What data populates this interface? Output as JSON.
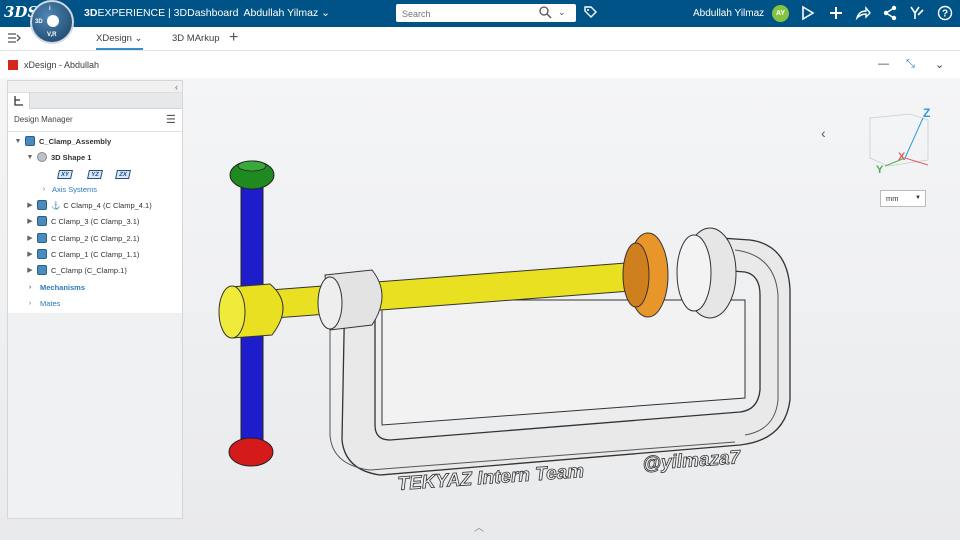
{
  "topbar": {
    "logo": "3DS",
    "compass": {
      "q1": "3D",
      "q2": "V,R",
      "q3": "i"
    },
    "brand_prefix": "3D",
    "brand_main": "EXPERIENCE | 3DDashboard",
    "brand_user": "Abdullah Yilmaz ⌄",
    "search_placeholder": "Search",
    "user_name": "Abdullah Yilmaz",
    "avatar_initials": "AY"
  },
  "tabs": [
    {
      "label": "XDesign ⌄",
      "active": true
    },
    {
      "label": "3D MArkup",
      "active": false
    }
  ],
  "app": {
    "title": "xDesign - Abdullah"
  },
  "panel": {
    "title": "Design Manager",
    "tree": [
      {
        "label": "C_Clamp_Assembly",
        "toggle": "▼",
        "style": "bold"
      },
      {
        "label": "3D Shape 1",
        "toggle": "▼",
        "style": "bold"
      },
      {
        "label": "Axis Systems",
        "toggle": "›",
        "style": "link"
      },
      {
        "label": "C Clamp_4 (C Clamp_4.1)",
        "toggle": "▶",
        "style": "normal"
      },
      {
        "label": "C Clamp_3 (C Clamp_3.1)",
        "toggle": "▶",
        "style": "normal"
      },
      {
        "label": "C Clamp_2 (C Clamp_2.1)",
        "toggle": "▶",
        "style": "normal"
      },
      {
        "label": "C Clamp_1 (C Clamp_1.1)",
        "toggle": "▶",
        "style": "normal"
      },
      {
        "label": "C_Clamp (C_Clamp.1)",
        "toggle": "▶",
        "style": "normal"
      },
      {
        "label": "Mechanisms",
        "toggle": "›",
        "style": "blue"
      },
      {
        "label": "Mates",
        "toggle": "›",
        "style": "link"
      }
    ],
    "planes": [
      "XY",
      "YZ",
      "ZX"
    ]
  },
  "viewport": {
    "unit": "mm",
    "axes": {
      "x": "X",
      "y": "Y",
      "z": "Z"
    },
    "engraving_left": "TEKYAZ Intern Team",
    "engraving_right": "@yilmaza7"
  },
  "colors": {
    "topbar": "#005386",
    "handle": "#1d1dcc",
    "screw": "#e8e020",
    "cap_top": "#1f8a1f",
    "cap_bottom": "#d41a1a",
    "pad": "#e8962a",
    "frame": "#e6e6e6"
  }
}
